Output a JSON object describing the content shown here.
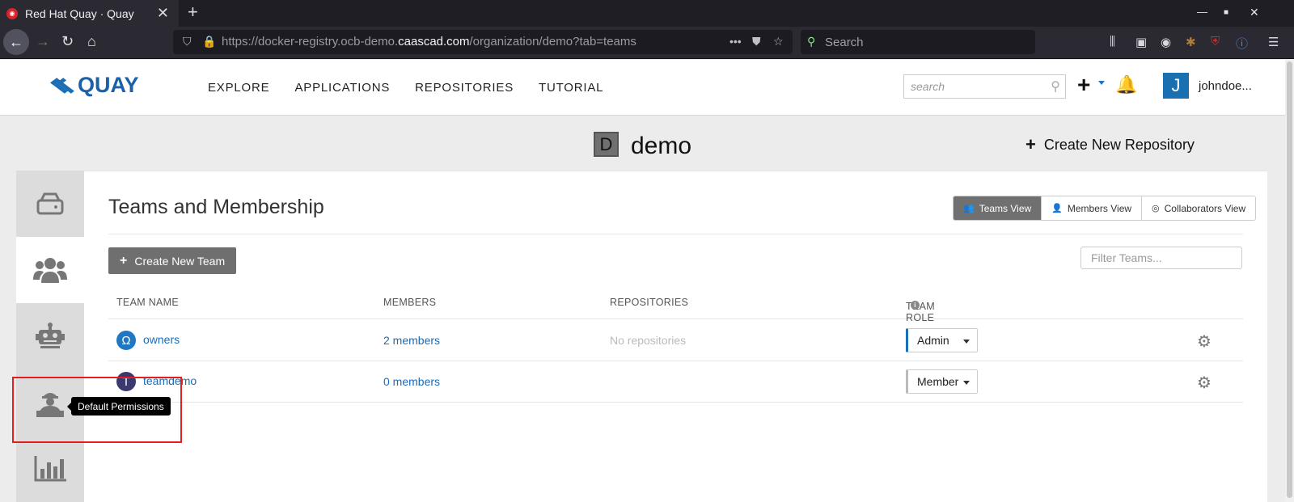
{
  "browser": {
    "tab_title": "Red Hat Quay · Quay",
    "url_prefix": "https://docker-registry.ocb-demo.",
    "url_domain": "caascad.com",
    "url_path": "/organization/demo?tab=teams",
    "search_placeholder": "Search"
  },
  "header": {
    "logo_text": "QUAY",
    "nav": [
      "EXPLORE",
      "APPLICATIONS",
      "REPOSITORIES",
      "TUTORIAL"
    ],
    "search_placeholder": "search",
    "avatar_letter": "J",
    "username": "johndoe..."
  },
  "org": {
    "avatar_letter": "D",
    "name": "demo",
    "create_repo_label": "Create New Repository"
  },
  "sidebar": {
    "items": [
      {
        "name": "repositories",
        "icon": "drive-icon",
        "active": false
      },
      {
        "name": "teams",
        "icon": "users-icon",
        "active": true
      },
      {
        "name": "robot-accounts",
        "icon": "robot-icon",
        "active": false
      },
      {
        "name": "default-permissions",
        "icon": "user-secret-icon",
        "active": false
      },
      {
        "name": "usage-logs",
        "icon": "bar-chart-icon",
        "active": false
      }
    ],
    "tooltip": "Default Permissions"
  },
  "panel": {
    "title": "Teams and Membership",
    "views": [
      "Teams View",
      "Members View",
      "Collaborators View"
    ],
    "active_view": "Teams View",
    "create_team_label": "Create New Team",
    "filter_placeholder": "Filter Teams...",
    "columns": [
      "TEAM NAME",
      "MEMBERS",
      "REPOSITORIES",
      "TEAM ROLE"
    ],
    "teams": [
      {
        "avatar": "Ω",
        "avatar_color": "#1f78c1",
        "name": "owners",
        "members": "2 members",
        "repositories": "No repositories",
        "role": "Admin"
      },
      {
        "avatar": "T",
        "avatar_color": "#3a3a6e",
        "name": "teamdemo",
        "members": "0 members",
        "repositories": "",
        "role": "Member"
      }
    ]
  },
  "colors": {
    "link": "#1b6bb7",
    "brand": "#1a61a8",
    "highlight": "#e02020"
  }
}
